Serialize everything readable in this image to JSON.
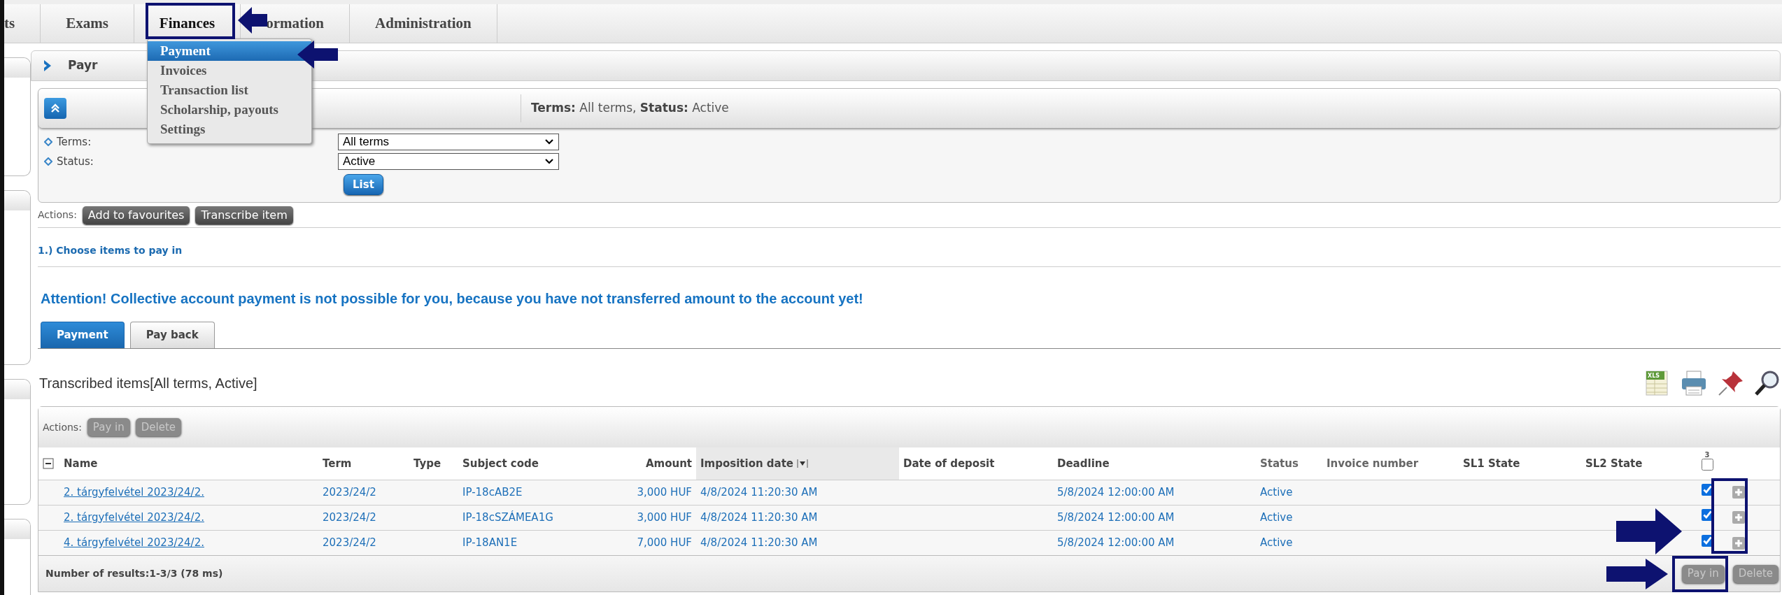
{
  "nav": {
    "tabs": [
      {
        "label": "ts",
        "selected": false
      },
      {
        "label": "Exams",
        "selected": false
      },
      {
        "label": "Finances",
        "selected": true
      },
      {
        "label": "ormation",
        "selected": false
      },
      {
        "label": "Administration",
        "selected": false
      }
    ]
  },
  "menu": {
    "items": [
      {
        "label": "Payment",
        "selected": true
      },
      {
        "label": "Invoices",
        "selected": false
      },
      {
        "label": "Transaction list",
        "selected": false
      },
      {
        "label": "Scholarship, payouts",
        "selected": false
      },
      {
        "label": "Settings",
        "selected": false
      }
    ]
  },
  "panel": {
    "title": "Payr"
  },
  "filter": {
    "summary": "**Terms:** All terms, **Status:** Active",
    "fields": [
      {
        "label": "Terms:",
        "value": "All terms"
      },
      {
        "label": "Status:",
        "value": "Active"
      }
    ],
    "button": "List"
  },
  "actions": {
    "label": "Actions:",
    "buttons": [
      "Add to favourites",
      "Transcribe item"
    ]
  },
  "step": "1.) Choose items to pay in",
  "attention": "Attention! Collective account payment is not possible for you, because you have not transferred amount to the account yet!",
  "tabs": [
    {
      "label": "Payment",
      "selected": true
    },
    {
      "label": "Pay back",
      "selected": false
    }
  ],
  "list": {
    "title": "Transcribed items[All terms, Active]",
    "export_label": "XLS"
  },
  "table": {
    "actions_label": "Actions:",
    "actions": [
      {
        "label": "Pay in",
        "disabled": true
      },
      {
        "label": "Delete",
        "disabled": true
      }
    ],
    "select_count": "3",
    "header_checked": false,
    "columns": [
      "Name",
      "Term",
      "Type",
      "Subject code",
      "Amount",
      "Imposition date",
      "Date of deposit",
      "Deadline",
      "Status",
      "Invoice number",
      "SL1 State",
      "SL2 State"
    ],
    "rows": [
      {
        "cells": [
          "2. tárgyfelvétel 2023/24/2.",
          "2023/24/2",
          "",
          "IP-18cAB2E",
          "3,000 HUF",
          "4/8/2024 11:20:30 AM",
          "",
          "5/8/2024 12:00:00 AM",
          "Active",
          "",
          "",
          ""
        ],
        "checked": true
      },
      {
        "cells": [
          "2. tárgyfelvétel 2023/24/2.",
          "2023/24/2",
          "",
          "IP-18cSZÁMEA1G",
          "3,000 HUF",
          "4/8/2024 11:20:30 AM",
          "",
          "5/8/2024 12:00:00 AM",
          "Active",
          "",
          "",
          ""
        ],
        "checked": true
      },
      {
        "cells": [
          "4. tárgyfelvétel 2023/24/2.",
          "2023/24/2",
          "",
          "IP-18AN1E",
          "7,000 HUF",
          "4/8/2024 11:20:30 AM",
          "",
          "5/8/2024 12:00:00 AM",
          "Active",
          "",
          "",
          ""
        ],
        "checked": true
      }
    ],
    "footer": "Number of results:1-3/3 (78 ms)",
    "footer_actions": [
      {
        "label": "Pay in",
        "disabled": true
      },
      {
        "label": "Delete",
        "disabled": true
      }
    ]
  }
}
